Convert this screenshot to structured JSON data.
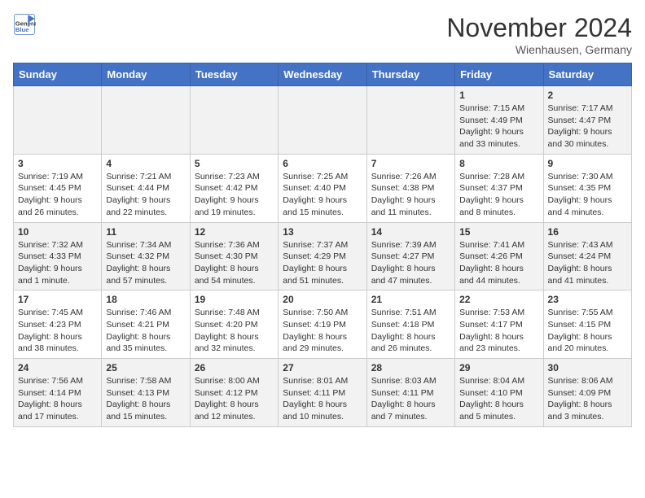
{
  "header": {
    "logo_general": "General",
    "logo_blue": "Blue",
    "month_title": "November 2024",
    "location": "Wienhausen, Germany"
  },
  "columns": [
    "Sunday",
    "Monday",
    "Tuesday",
    "Wednesday",
    "Thursday",
    "Friday",
    "Saturday"
  ],
  "weeks": [
    [
      {
        "day": "",
        "info": ""
      },
      {
        "day": "",
        "info": ""
      },
      {
        "day": "",
        "info": ""
      },
      {
        "day": "",
        "info": ""
      },
      {
        "day": "",
        "info": ""
      },
      {
        "day": "1",
        "info": "Sunrise: 7:15 AM\nSunset: 4:49 PM\nDaylight: 9 hours\nand 33 minutes."
      },
      {
        "day": "2",
        "info": "Sunrise: 7:17 AM\nSunset: 4:47 PM\nDaylight: 9 hours\nand 30 minutes."
      }
    ],
    [
      {
        "day": "3",
        "info": "Sunrise: 7:19 AM\nSunset: 4:45 PM\nDaylight: 9 hours\nand 26 minutes."
      },
      {
        "day": "4",
        "info": "Sunrise: 7:21 AM\nSunset: 4:44 PM\nDaylight: 9 hours\nand 22 minutes."
      },
      {
        "day": "5",
        "info": "Sunrise: 7:23 AM\nSunset: 4:42 PM\nDaylight: 9 hours\nand 19 minutes."
      },
      {
        "day": "6",
        "info": "Sunrise: 7:25 AM\nSunset: 4:40 PM\nDaylight: 9 hours\nand 15 minutes."
      },
      {
        "day": "7",
        "info": "Sunrise: 7:26 AM\nSunset: 4:38 PM\nDaylight: 9 hours\nand 11 minutes."
      },
      {
        "day": "8",
        "info": "Sunrise: 7:28 AM\nSunset: 4:37 PM\nDaylight: 9 hours\nand 8 minutes."
      },
      {
        "day": "9",
        "info": "Sunrise: 7:30 AM\nSunset: 4:35 PM\nDaylight: 9 hours\nand 4 minutes."
      }
    ],
    [
      {
        "day": "10",
        "info": "Sunrise: 7:32 AM\nSunset: 4:33 PM\nDaylight: 9 hours\nand 1 minute."
      },
      {
        "day": "11",
        "info": "Sunrise: 7:34 AM\nSunset: 4:32 PM\nDaylight: 8 hours\nand 57 minutes."
      },
      {
        "day": "12",
        "info": "Sunrise: 7:36 AM\nSunset: 4:30 PM\nDaylight: 8 hours\nand 54 minutes."
      },
      {
        "day": "13",
        "info": "Sunrise: 7:37 AM\nSunset: 4:29 PM\nDaylight: 8 hours\nand 51 minutes."
      },
      {
        "day": "14",
        "info": "Sunrise: 7:39 AM\nSunset: 4:27 PM\nDaylight: 8 hours\nand 47 minutes."
      },
      {
        "day": "15",
        "info": "Sunrise: 7:41 AM\nSunset: 4:26 PM\nDaylight: 8 hours\nand 44 minutes."
      },
      {
        "day": "16",
        "info": "Sunrise: 7:43 AM\nSunset: 4:24 PM\nDaylight: 8 hours\nand 41 minutes."
      }
    ],
    [
      {
        "day": "17",
        "info": "Sunrise: 7:45 AM\nSunset: 4:23 PM\nDaylight: 8 hours\nand 38 minutes."
      },
      {
        "day": "18",
        "info": "Sunrise: 7:46 AM\nSunset: 4:21 PM\nDaylight: 8 hours\nand 35 minutes."
      },
      {
        "day": "19",
        "info": "Sunrise: 7:48 AM\nSunset: 4:20 PM\nDaylight: 8 hours\nand 32 minutes."
      },
      {
        "day": "20",
        "info": "Sunrise: 7:50 AM\nSunset: 4:19 PM\nDaylight: 8 hours\nand 29 minutes."
      },
      {
        "day": "21",
        "info": "Sunrise: 7:51 AM\nSunset: 4:18 PM\nDaylight: 8 hours\nand 26 minutes."
      },
      {
        "day": "22",
        "info": "Sunrise: 7:53 AM\nSunset: 4:17 PM\nDaylight: 8 hours\nand 23 minutes."
      },
      {
        "day": "23",
        "info": "Sunrise: 7:55 AM\nSunset: 4:15 PM\nDaylight: 8 hours\nand 20 minutes."
      }
    ],
    [
      {
        "day": "24",
        "info": "Sunrise: 7:56 AM\nSunset: 4:14 PM\nDaylight: 8 hours\nand 17 minutes."
      },
      {
        "day": "25",
        "info": "Sunrise: 7:58 AM\nSunset: 4:13 PM\nDaylight: 8 hours\nand 15 minutes."
      },
      {
        "day": "26",
        "info": "Sunrise: 8:00 AM\nSunset: 4:12 PM\nDaylight: 8 hours\nand 12 minutes."
      },
      {
        "day": "27",
        "info": "Sunrise: 8:01 AM\nSunset: 4:11 PM\nDaylight: 8 hours\nand 10 minutes."
      },
      {
        "day": "28",
        "info": "Sunrise: 8:03 AM\nSunset: 4:11 PM\nDaylight: 8 hours\nand 7 minutes."
      },
      {
        "day": "29",
        "info": "Sunrise: 8:04 AM\nSunset: 4:10 PM\nDaylight: 8 hours\nand 5 minutes."
      },
      {
        "day": "30",
        "info": "Sunrise: 8:06 AM\nSunset: 4:09 PM\nDaylight: 8 hours\nand 3 minutes."
      }
    ]
  ]
}
